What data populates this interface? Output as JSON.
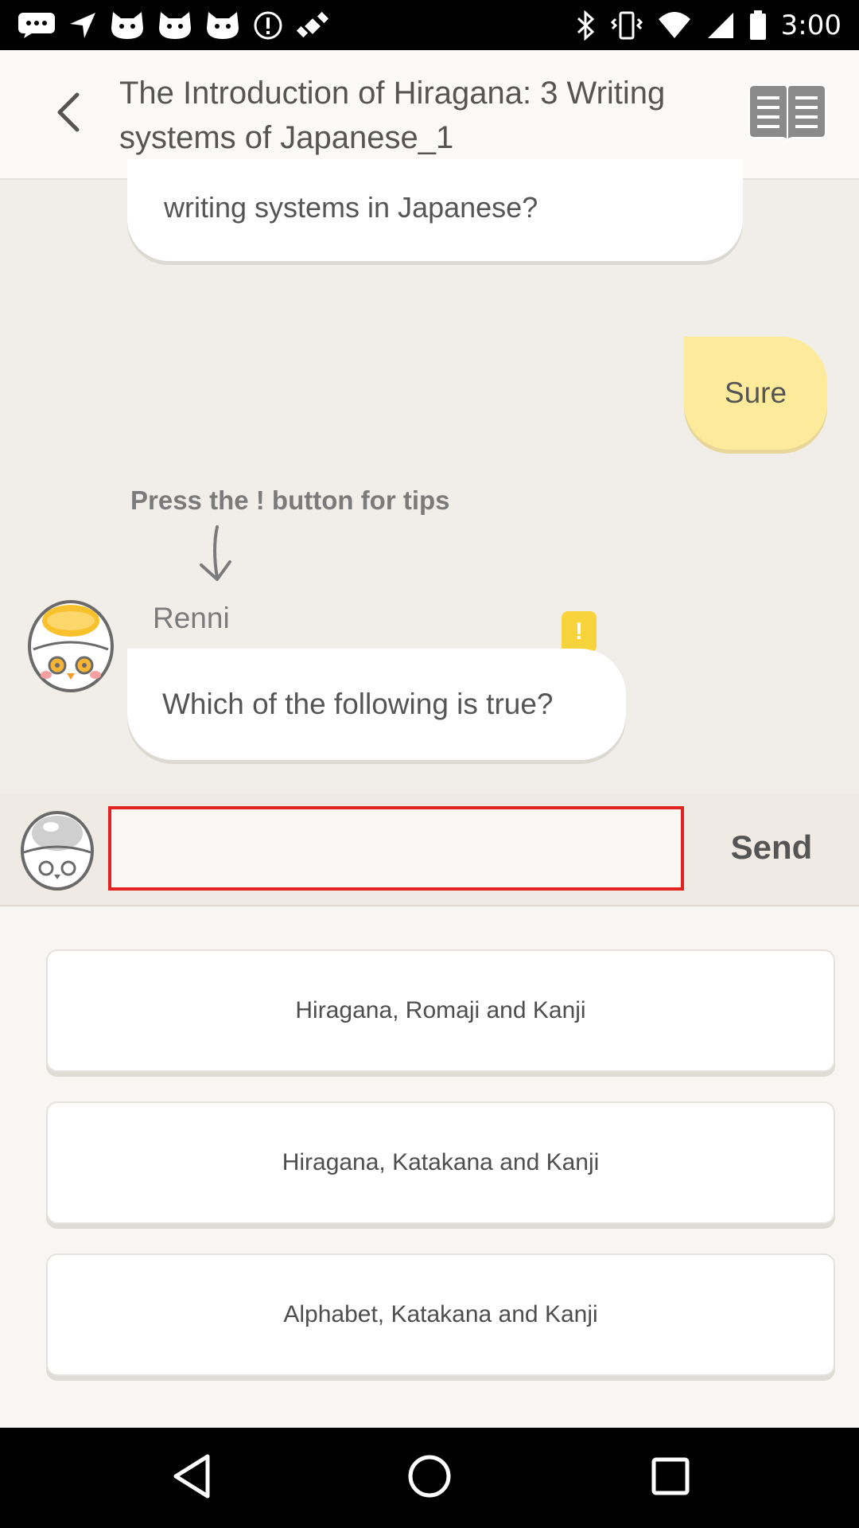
{
  "status_bar": {
    "time": "3:00",
    "left_icons": [
      "messages-icon",
      "navigation-icon",
      "cat-icon",
      "cat-icon",
      "cat-icon",
      "alert-icon",
      "fake-gps-icon"
    ],
    "right_icons": [
      "bluetooth-icon",
      "vibrate-icon",
      "wifi-icon",
      "signal-icon",
      "battery-icon"
    ]
  },
  "header": {
    "title": "The Introduction of Hiragana: 3 Writing systems of Japanese_1"
  },
  "chat": {
    "prev_bubble_text": "writing systems in Japanese?",
    "user_reply": "Sure",
    "tips_hint": "Press the ! button for tips",
    "speaker_name": "Renni",
    "tip_button_label": "!",
    "question": "Which of the following is true?"
  },
  "input": {
    "value": "",
    "placeholder": "",
    "send_label": "Send"
  },
  "options": [
    {
      "label": "Hiragana, Romaji and Kanji"
    },
    {
      "label": "Hiragana, Katakana and Kanji"
    },
    {
      "label": "Alphabet, Katakana and Kanji"
    }
  ],
  "colors": {
    "chat_background": "#f1eeea",
    "user_bubble": "#fdeb9b",
    "tip_button": "#f8d43c",
    "input_border": "#e32222"
  }
}
